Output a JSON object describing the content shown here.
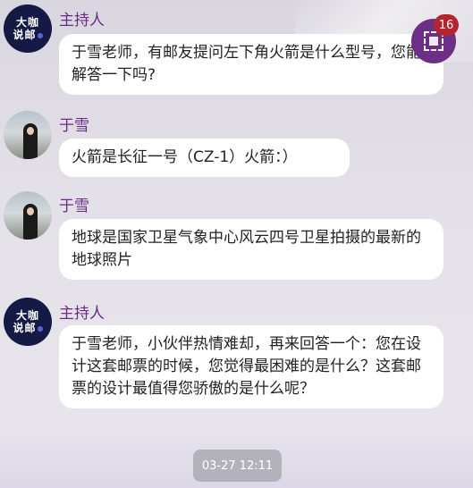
{
  "messages": [
    {
      "sender": "主持人",
      "avatar": "host-logo-icon",
      "avatar_text": [
        "大咖",
        "说邮"
      ],
      "text": "于雪老师，有邮友提问左下角火箭是什么型号，您能解答一下吗?"
    },
    {
      "sender": "于雪",
      "avatar": "guest-photo-icon",
      "text": "火箭是长征一号（CZ-1）火箭：）"
    },
    {
      "sender": "于雪",
      "avatar": "guest-photo-icon",
      "text": "地球是国家卫星气象中心风云四号卫星拍摄的最新的地球照片"
    },
    {
      "sender": "主持人",
      "avatar": "host-logo-icon",
      "avatar_text": [
        "大咖",
        "说邮"
      ],
      "text": "于雪老师，小伙伴热情难却，再来回答一个：您在设计这套邮票的时候，您觉得最困难的是什么？这套邮票的设计最值得您骄傲的是什么呢？"
    }
  ],
  "floating": {
    "icon": "stamp-icon",
    "badge_count": "16"
  },
  "timestamp": "03-27 12:11",
  "colors": {
    "accent": "#6a2a86",
    "badge": "#b3242e",
    "host_avatar": "#141a44"
  }
}
